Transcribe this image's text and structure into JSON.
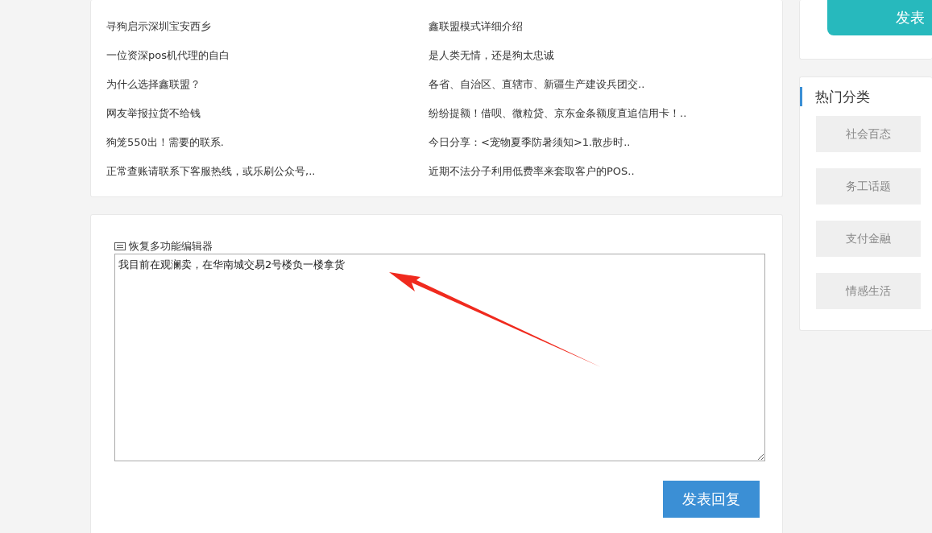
{
  "article_list": {
    "left": [
      "寻狗启示深圳宝安西乡",
      "一位资深pos机代理的自白",
      "为什么选择鑫联盟？",
      "网友举报拉货不给钱",
      "狗笼550出！需要的联系.",
      "正常查账请联系下客服热线，或乐刷公众号,.."
    ],
    "right": [
      "鑫联盟模式详细介绍",
      "是人类无情，还是狗太忠诚",
      "各省、自治区、直辖市、新疆生产建设兵团交..",
      "纷纷提额！借呗、微粒贷、京东金条额度直追信用卡！..",
      "今日分享：<宠物夏季防暑须知>1.散步时..",
      "近期不法分子利用低费率来套取客户的POS.."
    ]
  },
  "reply_editor": {
    "label": "恢复多功能编辑器",
    "value": "我目前在观澜卖，在华南城交易2号楼负一楼拿货",
    "submit_button": "发表回复"
  },
  "sidebar": {
    "post_button": "发表",
    "categories_title": "热门分类",
    "categories": [
      "社会百态",
      "务工话题",
      "支付金融",
      "情感生活"
    ]
  }
}
